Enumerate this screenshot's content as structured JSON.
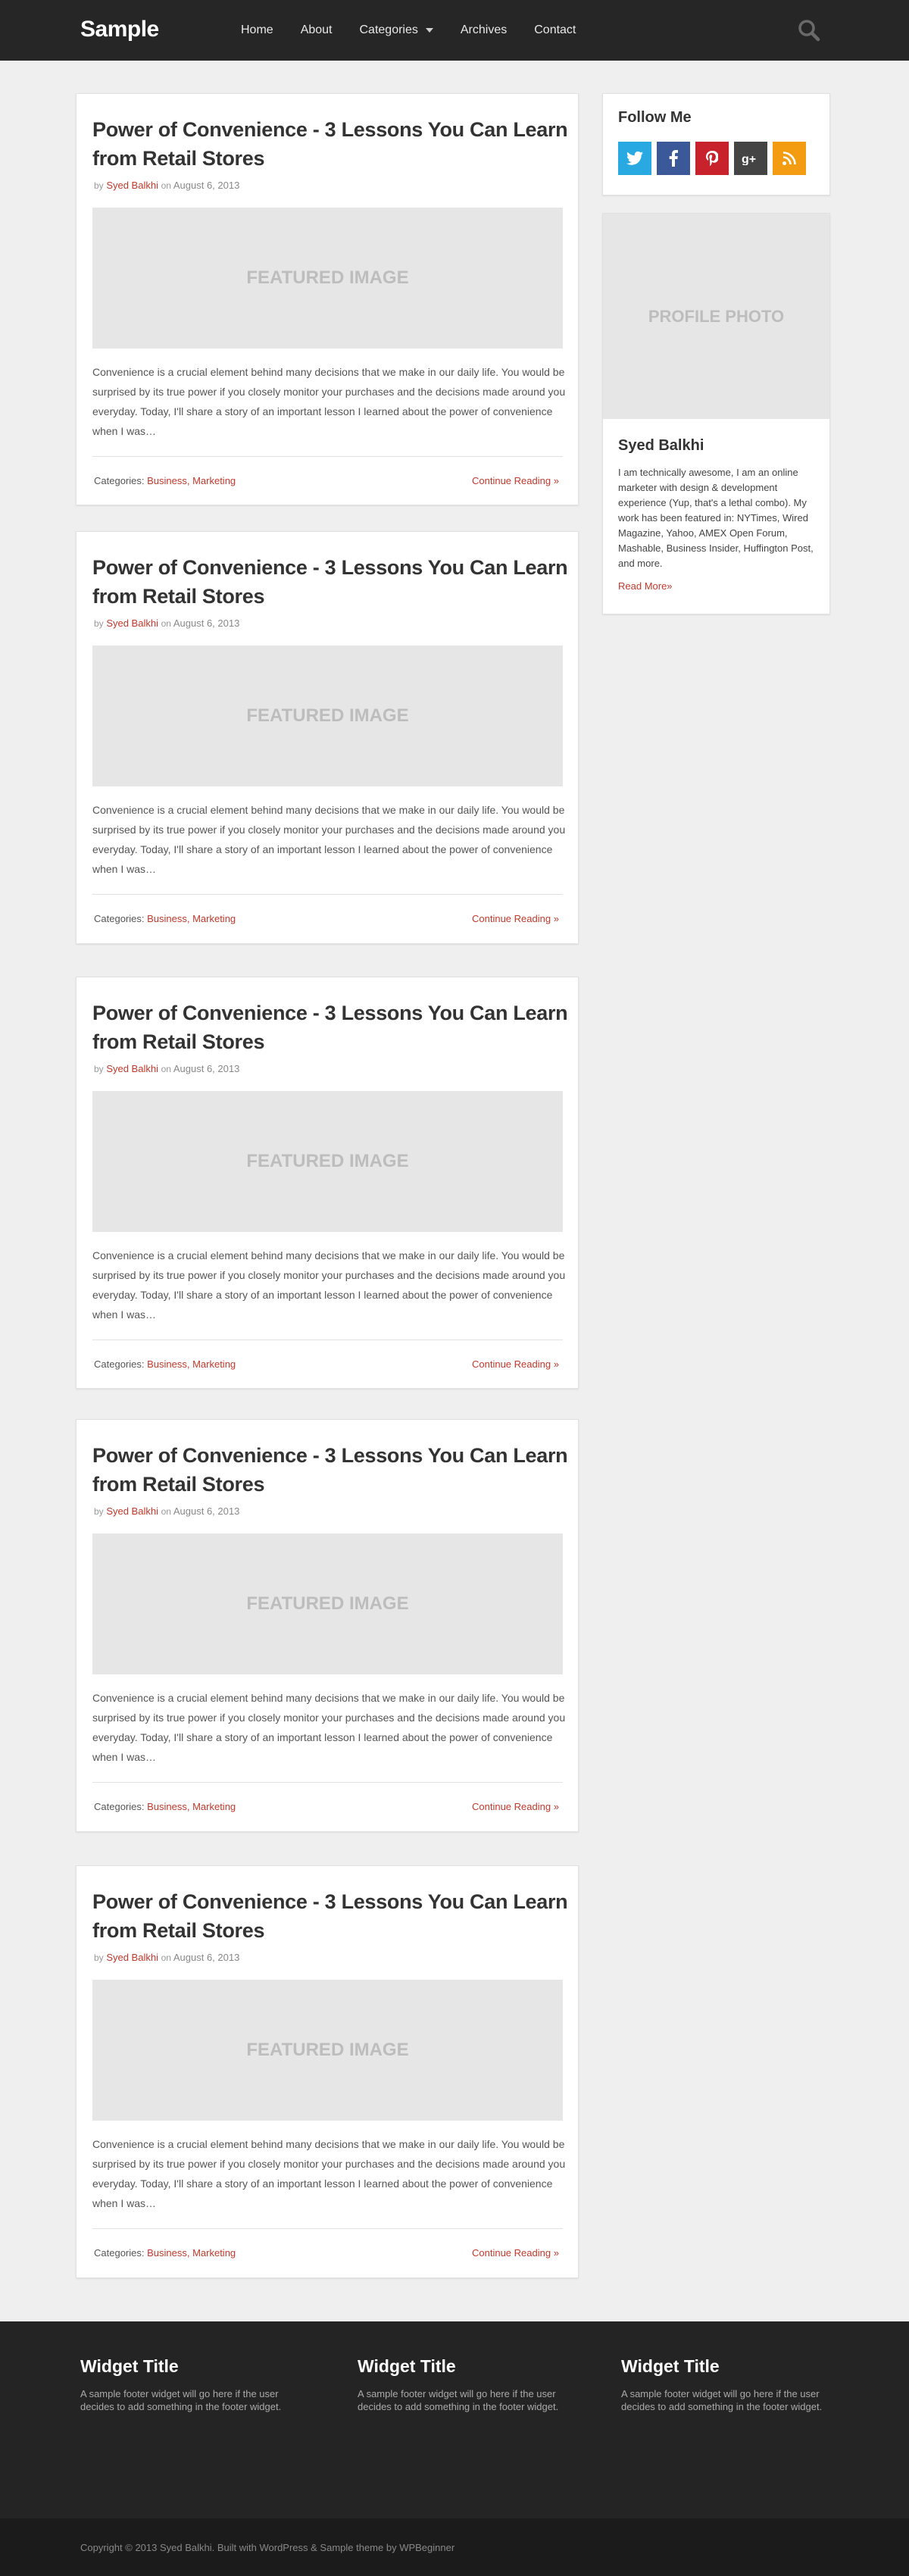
{
  "header": {
    "logo": "Sample",
    "nav": [
      "Home",
      "About",
      "Categories",
      "Archives",
      "Contact"
    ]
  },
  "posts": [
    {
      "title": "Power of Convenience - 3 Lessons You Can Learn from Retail Stores",
      "by": "by",
      "author": "Syed Balkhi",
      "on": "on",
      "date": "August 6, 2013",
      "featured": "FEATURED IMAGE",
      "excerpt": "Convenience is a crucial element behind many decisions that we make in our daily life. You would be surprised by its true power if you closely monitor your purchases and the decisions made around you everyday. Today, I'll share a story of an important lesson I learned about the power of convenience when I was…",
      "categories_label": "Categories:",
      "categories": "Business, Marketing",
      "continue": "Continue Reading »"
    },
    {
      "title": "Power of Convenience - 3 Lessons You Can Learn from Retail Stores",
      "by": "by",
      "author": "Syed Balkhi",
      "on": "on",
      "date": "August 6, 2013",
      "featured": "FEATURED IMAGE",
      "excerpt": "Convenience is a crucial element behind many decisions that we make in our daily life. You would be surprised by its true power if you closely monitor your purchases and the decisions made around you everyday. Today, I'll share a story of an important lesson I learned about the power of convenience when I was…",
      "categories_label": "Categories:",
      "categories": "Business, Marketing",
      "continue": "Continue Reading »"
    },
    {
      "title": "Power of Convenience - 3 Lessons You Can Learn from Retail Stores",
      "by": "by",
      "author": "Syed Balkhi",
      "on": "on",
      "date": "August 6, 2013",
      "featured": "FEATURED IMAGE",
      "excerpt": "Convenience is a crucial element behind many decisions that we make in our daily life. You would be surprised by its true power if you closely monitor your purchases and the decisions made around you everyday. Today, I'll share a story of an important lesson I learned about the power of convenience when I was…",
      "categories_label": "Categories:",
      "categories": "Business, Marketing",
      "continue": "Continue Reading »"
    },
    {
      "title": "Power of Convenience - 3 Lessons You Can Learn from Retail Stores",
      "by": "by",
      "author": "Syed Balkhi",
      "on": "on",
      "date": "August 6, 2013",
      "featured": "FEATURED IMAGE",
      "excerpt": "Convenience is a crucial element behind many decisions that we make in our daily life. You would be surprised by its true power if you closely monitor your purchases and the decisions made around you everyday. Today, I'll share a story of an important lesson I learned about the power of convenience when I was…",
      "categories_label": "Categories:",
      "categories": "Business, Marketing",
      "continue": "Continue Reading »"
    },
    {
      "title": "Power of Convenience - 3 Lessons You Can Learn from Retail Stores",
      "by": "by",
      "author": "Syed Balkhi",
      "on": "on",
      "date": "August 6, 2013",
      "featured": "FEATURED IMAGE",
      "excerpt": "Convenience is a crucial element behind many decisions that we make in our daily life. You would be surprised by its true power if you closely monitor your purchases and the decisions made around you everyday. Today, I'll share a story of an important lesson I learned about the power of convenience when I was…",
      "categories_label": "Categories:",
      "categories": "Business, Marketing",
      "continue": "Continue Reading »"
    }
  ],
  "sidebar": {
    "follow_title": "Follow Me",
    "social": [
      {
        "name": "twitter-icon",
        "color": "#29a9e1"
      },
      {
        "name": "facebook-icon",
        "color": "#3b5998"
      },
      {
        "name": "pinterest-icon",
        "color": "#c8232c"
      },
      {
        "name": "google-plus-icon",
        "color": "#444444"
      },
      {
        "name": "rss-icon",
        "color": "#f39c12"
      }
    ],
    "profile_photo": "PROFILE PHOTO",
    "profile_name": "Syed Balkhi",
    "profile_bio": "I am technically awesome, I am an online marketer with design & development experience (Yup, that's a lethal combo). My work has been featured in: NYTimes, Wired Magazine, Yahoo, AMEX Open Forum, Mashable, Business Insider, Huffington Post, and more.",
    "profile_more": "Read More»"
  },
  "footer": {
    "widgets": [
      {
        "title": "Widget Title",
        "text": "A sample footer widget will go here if the user decides to add something in the footer widget."
      },
      {
        "title": "Widget Title",
        "text": "A sample footer widget will go here if the user decides to add something in the footer widget."
      },
      {
        "title": "Widget Title",
        "text": "A sample footer widget will go here if the user decides to add something in the footer widget."
      }
    ],
    "copyright": "Copyright © 2013 Syed Balkhi. Built with WordPress & Sample theme by WPBeginner"
  },
  "colors": {
    "accent": "#c0392b",
    "header_bg": "#262626",
    "footer_bg": "#242424"
  }
}
